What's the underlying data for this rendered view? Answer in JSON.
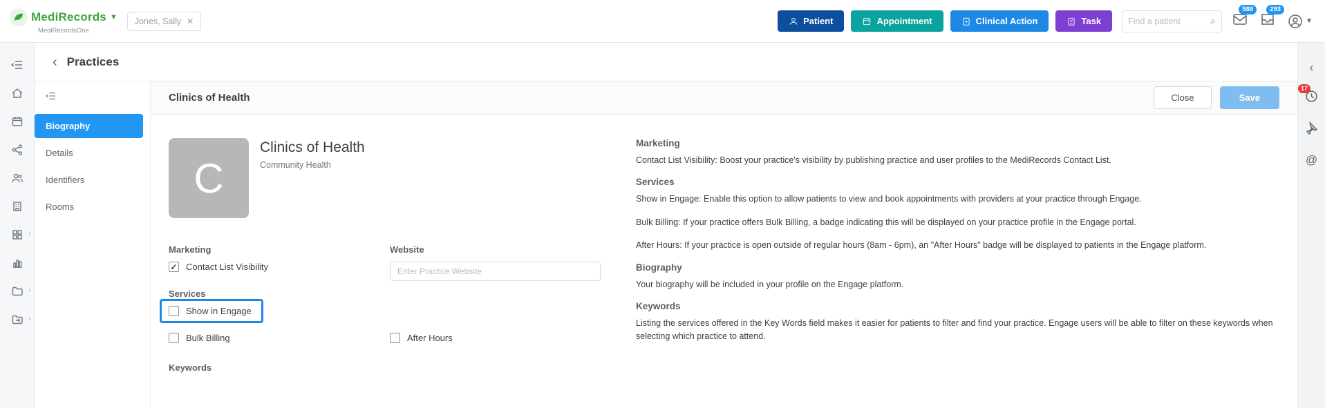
{
  "header": {
    "brand": "MediRecords",
    "brand_sub": "MediRecordsOne",
    "patient_chip": "Jones, Sally",
    "buttons": [
      {
        "label": "Patient",
        "color": "#0d4f9e"
      },
      {
        "label": "Appointment",
        "color": "#0aa3a0"
      },
      {
        "label": "Clinical Action",
        "color": "#1e88e5"
      },
      {
        "label": "Task",
        "color": "#7c3fd1"
      }
    ],
    "search_placeholder": "Find a patient",
    "mail_badge": "588",
    "inbox_badge": "293"
  },
  "breadcrumb": {
    "title": "Practices"
  },
  "subnav": {
    "items": [
      {
        "label": "Biography"
      },
      {
        "label": "Details"
      },
      {
        "label": "Identifiers"
      },
      {
        "label": "Rooms"
      }
    ],
    "active_index": 0
  },
  "panel": {
    "title": "Clinics of Health",
    "close_label": "Close",
    "save_label": "Save"
  },
  "practice": {
    "avatar_letter": "C",
    "name": "Clinics of Health",
    "subtitle": "Community Health"
  },
  "form": {
    "marketing_heading": "Marketing",
    "contact_list_label": "Contact List Visibility",
    "contact_list_checked": true,
    "website_label": "Website",
    "website_placeholder": "Enter Practice Website",
    "services_heading": "Services",
    "show_in_engage_label": "Show in Engage",
    "show_in_engage_checked": false,
    "bulk_billing_label": "Bulk Billing",
    "bulk_billing_checked": false,
    "after_hours_label": "After Hours",
    "after_hours_checked": false,
    "keywords_heading": "Keywords",
    "highlight_color": "#1e88e5"
  },
  "help": {
    "sections": [
      {
        "heading": "Marketing",
        "paragraphs": [
          "Contact List Visibility: Boost your practice's visibility by publishing practice and user profiles to the MediRecords Contact List."
        ]
      },
      {
        "heading": "Services",
        "paragraphs": [
          "Show in Engage: Enable this option to allow patients to view and book appointments with providers at your practice through Engage.",
          "Bulk Billing: If your practice offers Bulk Billing, a badge indicating this will be displayed on your practice profile in the Engage portal.",
          "After Hours: If your practice is open outside of regular hours (8am - 6pm), an \"After Hours\" badge will be displayed to patients in the Engage platform."
        ]
      },
      {
        "heading": "Biography",
        "paragraphs": [
          "Your biography will be included in your profile on the Engage platform."
        ]
      },
      {
        "heading": "Keywords",
        "paragraphs": [
          "Listing the services offered in the Key Words field makes it easier for patients to filter and find your practice. Engage users will be able to filter on these keywords when selecting which practice to attend."
        ]
      }
    ]
  },
  "right_rail": {
    "notification_badge": "17"
  }
}
